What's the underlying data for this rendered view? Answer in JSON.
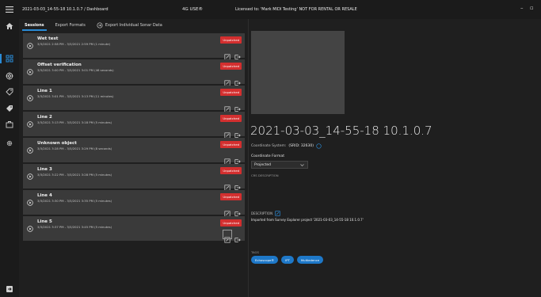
{
  "titlebar": {
    "title": "2021-03-03_14-55-18 10.1.0.7 / Dashboard",
    "usb": "4G USE®",
    "license": "Licensed to: 'Mark MIDI Testing' NOT FOR RENTAL OR RESALE",
    "minimize": "–",
    "restore": "▫"
  },
  "rail": {
    "icons": [
      "home-icon",
      "dashboard-icon",
      "sonar-icon",
      "tag-icon",
      "tag-alt-icon",
      "briefcase-icon",
      "settings-icon",
      "exit-icon"
    ]
  },
  "tabs": [
    {
      "label": "Sessions",
      "active": true
    },
    {
      "label": "Export Formats",
      "active": false
    },
    {
      "label": "Export Individual Sonar Data",
      "active": false
    }
  ],
  "sessions": [
    {
      "name": "Wet test",
      "time": "3/3/2021 2:58 PM - 3/3/2021 2:59 PM (1 minute)",
      "badge": "Unpatched"
    },
    {
      "name": "Offset verification",
      "time": "3/3/2021 3:00 PM - 3/3/2021 3:01 PM (46 seconds)",
      "badge": "Unpatched"
    },
    {
      "name": "Line 1",
      "time": "3/3/2021 3:01 PM - 3/3/2021 3:13 PM (11 minutes)",
      "badge": "Unpatched"
    },
    {
      "name": "Line 2",
      "time": "3/3/2021 3:13 PM - 3/3/2021 3:18 PM (5 minutes)",
      "badge": "Unpatched"
    },
    {
      "name": "Unknown object",
      "time": "3/3/2021 3:28 PM - 3/3/2021 3:29 PM (8 seconds)",
      "badge": "Unpatched"
    },
    {
      "name": "Line 3",
      "time": "3/3/2021 3:22 PM - 3/3/2021 3:28 PM (5 minutes)",
      "badge": "Unpatched"
    },
    {
      "name": "Line 4",
      "time": "3/3/2021 3:30 PM - 3/3/2021 3:35 PM (5 minutes)",
      "badge": "Unpatched"
    },
    {
      "name": "Line 5",
      "time": "3/3/2021 3:37 PM - 3/3/2021 3:45 PM (5 minutes)",
      "badge": "Unpatched"
    }
  ],
  "detail": {
    "title": "2021-03-03_14-55-18 10.1.0.7",
    "coord_system_label": "Coordinate System:",
    "coord_system_value": "(SRID: 32630)",
    "coord_format_label": "Coordinate Format",
    "coord_format_value": "Projected",
    "crs_description": "CRS DESCRIPTION",
    "description_label": "DESCRIPTION",
    "description_text": "Imported from Survey Explorer project '2021-03-03_14-55-18 10.1.0.7'",
    "tags_label": "TAGS",
    "tags": [
      "Echoscope®",
      "IPT",
      "Multiedence"
    ]
  },
  "colors": {
    "accent": "#2a8bd6",
    "badge": "#d32f2f",
    "tag": "#1e78c8",
    "card": "#3a3a3a"
  }
}
